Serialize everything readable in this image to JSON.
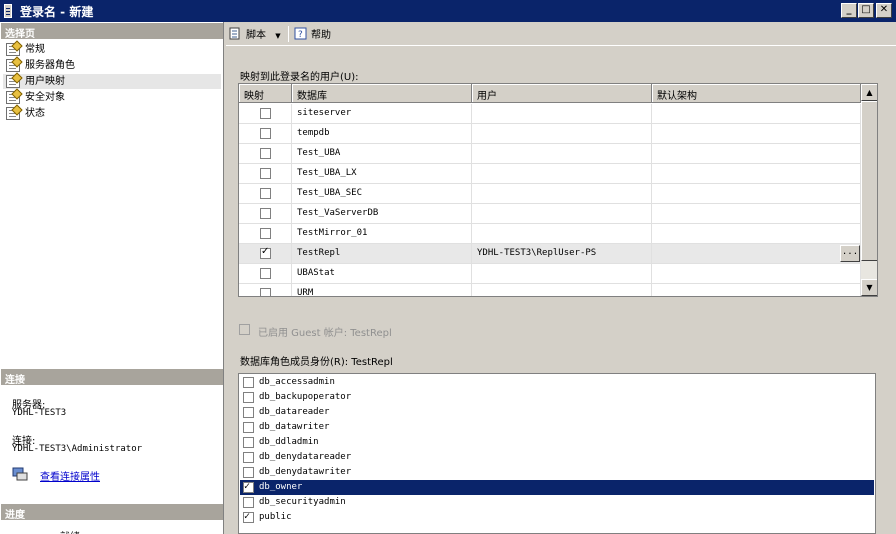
{
  "window": {
    "title": "登录名 - 新建"
  },
  "left": {
    "select_page_header": "选择页",
    "nav_items": [
      {
        "label": "常规"
      },
      {
        "label": "服务器角色"
      },
      {
        "label": "用户映射",
        "selected": true
      },
      {
        "label": "安全对象"
      },
      {
        "label": "状态"
      }
    ],
    "connection_header": "连接",
    "server_label": "服务器:",
    "server_value": "YDHL-TEST3",
    "connection_label": "连接:",
    "connection_value": "YDHL-TEST3\\Administrator",
    "view_link": "查看连接属性",
    "progress_header": "进度",
    "progress_text": "就绪"
  },
  "toolbar": {
    "script_label": "脚本",
    "help_label": "帮助"
  },
  "mapping": {
    "label": "映射到此登录名的用户(U):",
    "columns": [
      "映射",
      "数据库",
      "用户",
      "默认架构"
    ],
    "rows": [
      {
        "db": "siteserver",
        "user": "",
        "schema": "",
        "checked": false
      },
      {
        "db": "tempdb",
        "user": "",
        "schema": "",
        "checked": false
      },
      {
        "db": "Test_UBA",
        "user": "",
        "schema": "",
        "checked": false
      },
      {
        "db": "Test_UBA_LX",
        "user": "",
        "schema": "",
        "checked": false
      },
      {
        "db": "Test_UBA_SEC",
        "user": "",
        "schema": "",
        "checked": false
      },
      {
        "db": "Test_VaServerDB",
        "user": "",
        "schema": "",
        "checked": false
      },
      {
        "db": "TestMirror_01",
        "user": "",
        "schema": "",
        "checked": false
      },
      {
        "db": "TestRepl",
        "user": "YDHL-TEST3\\ReplUser-PS",
        "schema": "",
        "checked": true,
        "selected": true
      },
      {
        "db": "UBAStat",
        "user": "",
        "schema": "",
        "checked": false
      },
      {
        "db": "URM",
        "user": "",
        "schema": "",
        "checked": false
      }
    ],
    "ellipsis": "..."
  },
  "guest": {
    "label": "已启用 Guest 帐户: TestRepl"
  },
  "roles": {
    "label": "数据库角色成员身份(R): TestRepl",
    "items": [
      {
        "name": "db_accessadmin",
        "checked": false
      },
      {
        "name": "db_backupoperator",
        "checked": false
      },
      {
        "name": "db_datareader",
        "checked": false
      },
      {
        "name": "db_datawriter",
        "checked": false
      },
      {
        "name": "db_ddladmin",
        "checked": false
      },
      {
        "name": "db_denydatareader",
        "checked": false
      },
      {
        "name": "db_denydatawriter",
        "checked": false
      },
      {
        "name": "db_owner",
        "checked": true,
        "selected": true
      },
      {
        "name": "db_securityadmin",
        "checked": false
      },
      {
        "name": "public",
        "checked": true
      }
    ]
  }
}
